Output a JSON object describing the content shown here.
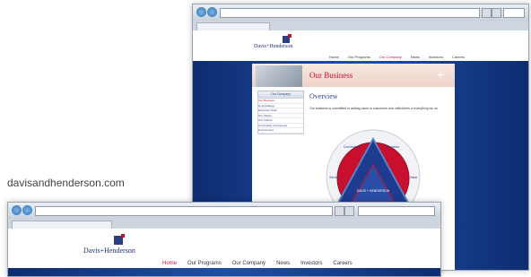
{
  "caption": "davisandhenderson.com",
  "site": {
    "logo_text": "Davis+Henderson",
    "nav": [
      "Home",
      "Our Programs",
      "Our Company",
      "News",
      "Investors",
      "Careers"
    ],
    "active_nav": "Our Company"
  },
  "page": {
    "hero_title": "Our Business",
    "sidebar_heading": "Our Company",
    "sidebar_items": [
      "Our Business",
      "D+H Strategy",
      "Executive Team",
      "Our Values",
      "Our Culture",
      "Community Involvement",
      "Environment"
    ],
    "section_title": "Overview",
    "body_text": "Our business is committed to adding value to customers and unitholders in everything we do.",
    "diagram_labels": {
      "center": "DAVIS + HENDERSON",
      "top_left": "Convenience",
      "top_right": "Assurance",
      "left": "Service",
      "right": "Value",
      "bottom": "PROGRAMS IN THE MARKETPLACE"
    }
  },
  "colors": {
    "brand_navy": "#1f2f6b",
    "brand_red": "#c8102e",
    "blue_bg": "#1e4fa6"
  }
}
